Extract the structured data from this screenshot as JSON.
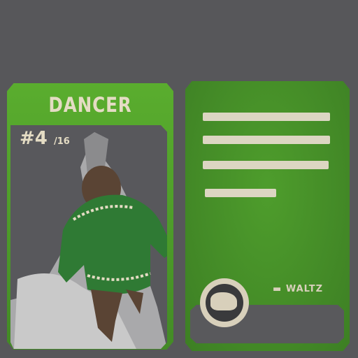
{
  "left_card": {
    "title": "DANCER",
    "number": "#4",
    "total": "/16",
    "colors": {
      "card": "#4f9a2c",
      "text": "#e4dcc4",
      "art_bg": "#58585c"
    }
  },
  "right_card": {
    "tag": "WALTZ",
    "emblem_icon": "bear-emblem-icon"
  }
}
